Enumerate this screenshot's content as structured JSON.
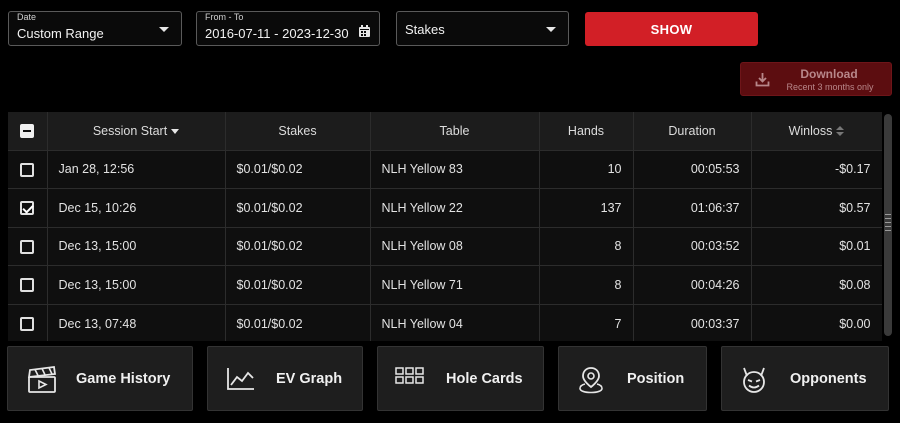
{
  "filters": {
    "date": {
      "label": "Date",
      "value": "Custom Range"
    },
    "range": {
      "label": "From - To",
      "value": "2016-07-11 - 2023-12-30"
    },
    "stakes": {
      "value": "Stakes"
    },
    "show_label": "SHOW"
  },
  "download": {
    "title": "Download",
    "subtitle": "Recent 3 months only"
  },
  "table": {
    "headers": {
      "session_start": "Session Start",
      "stakes": "Stakes",
      "table": "Table",
      "hands": "Hands",
      "duration": "Duration",
      "winloss": "Winloss"
    },
    "rows": [
      {
        "checked": false,
        "start": "Jan 28, 12:56",
        "stakes": "$0.01/$0.02",
        "table": "NLH Yellow 83",
        "hands": "10",
        "duration": "00:05:53",
        "winloss": "-$0.17"
      },
      {
        "checked": true,
        "start": "Dec 15, 10:26",
        "stakes": "$0.01/$0.02",
        "table": "NLH Yellow 22",
        "hands": "137",
        "duration": "01:06:37",
        "winloss": "$0.57"
      },
      {
        "checked": false,
        "start": "Dec 13, 15:00",
        "stakes": "$0.01/$0.02",
        "table": "NLH Yellow 08",
        "hands": "8",
        "duration": "00:03:52",
        "winloss": "$0.01"
      },
      {
        "checked": false,
        "start": "Dec 13, 15:00",
        "stakes": "$0.01/$0.02",
        "table": "NLH Yellow 71",
        "hands": "8",
        "duration": "00:04:26",
        "winloss": "$0.08"
      },
      {
        "checked": false,
        "start": "Dec 13, 07:48",
        "stakes": "$0.01/$0.02",
        "table": "NLH Yellow 04",
        "hands": "7",
        "duration": "00:03:37",
        "winloss": "$0.00"
      }
    ]
  },
  "nav": {
    "game_history": "Game History",
    "ev_graph": "EV Graph",
    "hole_cards": "Hole Cards",
    "position": "Position",
    "opponents": "Opponents"
  },
  "colors": {
    "accent": "#d21f26",
    "download_bg": "#5c0d10",
    "background": "#000000",
    "panel": "#1e1e1e"
  },
  "icons": {
    "date_caret": "chevron-down-icon",
    "range": "calendar-icon",
    "stakes_caret": "chevron-down-icon",
    "download": "download-icon",
    "game_history": "clapperboard-icon",
    "ev_graph": "line-chart-icon",
    "hole_cards": "grid-icon",
    "position": "map-pin-icon",
    "opponents": "devil-face-icon"
  }
}
